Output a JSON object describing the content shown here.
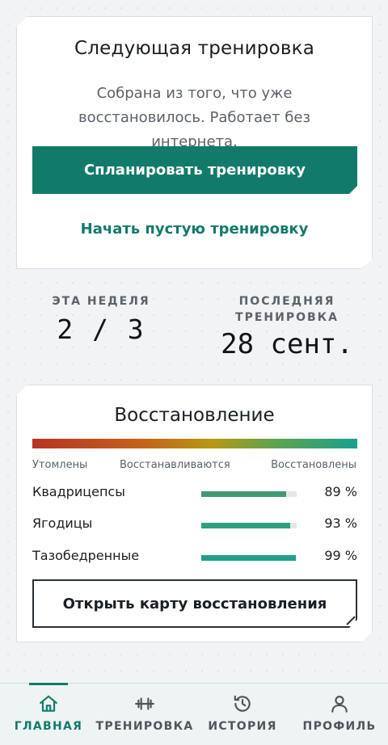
{
  "next_workout": {
    "title": "Следующая тренировка",
    "subtitle": "Собрана из того, что уже восстановилось. Работает без интернета.",
    "plan_button": "Спланировать тренировку",
    "empty_button": "Начать пустую тренировку"
  },
  "stats": {
    "week_label": "ЭТА НЕДЕЛЯ",
    "week_value": "2 / 3",
    "last_label": "ПОСЛЕДНЯЯ ТРЕНИРОВКА",
    "last_value": "28 сент."
  },
  "recovery": {
    "title": "Восстановление",
    "legend": {
      "low": "Утомлены",
      "mid": "Восстанавливаются",
      "high": "Восстановлены"
    },
    "muscles": [
      {
        "name": "Квадрицепсы",
        "percent_label": "89 %",
        "value": 0.89,
        "color": "#3f9a72"
      },
      {
        "name": "Ягодицы",
        "percent_label": "93 %",
        "value": 0.93,
        "color": "#2fa07f"
      },
      {
        "name": "Тазобедренные",
        "percent_label": "99 %",
        "value": 0.99,
        "color": "#1fa08c"
      }
    ],
    "map_button": "Открыть карту восстановления"
  },
  "nav": {
    "items": [
      {
        "label": "ГЛАВНАЯ",
        "icon": "home-icon",
        "active": true
      },
      {
        "label": "ТРЕНИРОВКА",
        "icon": "dumbbell-icon",
        "active": false
      },
      {
        "label": "ИСТОРИЯ",
        "icon": "history-icon",
        "active": false
      },
      {
        "label": "ПРОФИЛЬ",
        "icon": "profile-icon",
        "active": false
      }
    ]
  },
  "colors": {
    "accent": "#127a6a",
    "text": "#1a1f24",
    "muted": "#5b6269"
  }
}
